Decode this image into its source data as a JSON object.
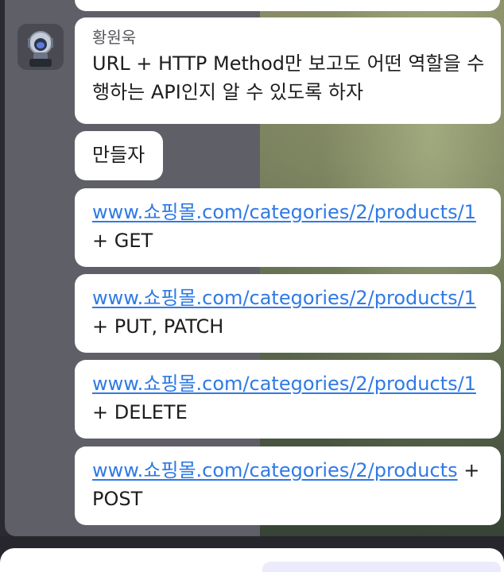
{
  "message_group": {
    "sender": "황원욱",
    "messages": [
      {
        "text": "URL + HTTP Method만 보고도 어떤 역할을 수행하는 API인지 알 수 있도록 하자"
      },
      {
        "text": "만들자"
      },
      {
        "link": "www.쇼핑몰.com/categories/2/products/1",
        "suffix": "+ GET"
      },
      {
        "link": "www.쇼핑몰.com/categories/2/products/1",
        "suffix": "+ PUT, PATCH"
      },
      {
        "link": "www.쇼핑몰.com/categories/2/products/1",
        "suffix": "+ DELETE"
      },
      {
        "link": "www.쇼핑몰.com/categories/2/products",
        "suffix": "+ POST"
      }
    ]
  },
  "icons": {
    "avatar": "robot-avatar-icon"
  }
}
